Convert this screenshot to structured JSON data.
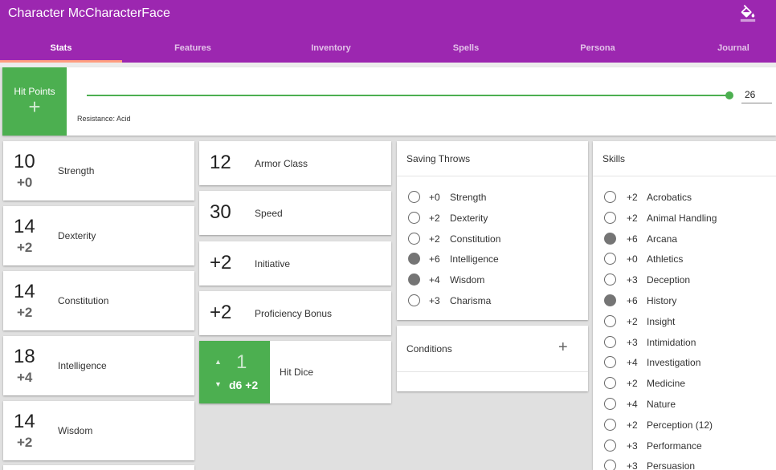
{
  "app": {
    "title": "Character McCharacterFace",
    "theme_color": "#9c27b0",
    "accent_color": "#4caf50",
    "theme_icon": "paint-bucket-icon"
  },
  "tabs": [
    {
      "label": "Stats",
      "active": true
    },
    {
      "label": "Features"
    },
    {
      "label": "Inventory"
    },
    {
      "label": "Spells"
    },
    {
      "label": "Persona"
    },
    {
      "label": "Journal"
    }
  ],
  "hit_points": {
    "label": "Hit Points",
    "add_symbol": "+",
    "value": "26",
    "resistance": "Resistance: Acid"
  },
  "abilities": [
    {
      "score": "10",
      "modifier": "+0",
      "name": "Strength"
    },
    {
      "score": "14",
      "modifier": "+2",
      "name": "Dexterity"
    },
    {
      "score": "14",
      "modifier": "+2",
      "name": "Constitution"
    },
    {
      "score": "18",
      "modifier": "+4",
      "name": "Intelligence"
    },
    {
      "score": "14",
      "modifier": "+2",
      "name": "Wisdom"
    }
  ],
  "combat": [
    {
      "value": "12",
      "label": "Armor Class"
    },
    {
      "value": "30",
      "label": "Speed"
    },
    {
      "value": "+2",
      "label": "Initiative"
    },
    {
      "value": "+2",
      "label": "Proficiency Bonus"
    }
  ],
  "hit_dice": {
    "count": "1",
    "die": "d6 +2",
    "label": "Hit Dice"
  },
  "saving_throws": {
    "title": "Saving Throws",
    "items": [
      {
        "modifier": "+0",
        "name": "Strength",
        "proficient": false
      },
      {
        "modifier": "+2",
        "name": "Dexterity",
        "proficient": false
      },
      {
        "modifier": "+2",
        "name": "Constitution",
        "proficient": false
      },
      {
        "modifier": "+6",
        "name": "Intelligence",
        "proficient": true
      },
      {
        "modifier": "+4",
        "name": "Wisdom",
        "proficient": true
      },
      {
        "modifier": "+3",
        "name": "Charisma",
        "proficient": false
      }
    ]
  },
  "conditions": {
    "title": "Conditions",
    "add_symbol": "+"
  },
  "skills": {
    "title": "Skills",
    "items": [
      {
        "modifier": "+2",
        "name": "Acrobatics",
        "proficient": false
      },
      {
        "modifier": "+2",
        "name": "Animal Handling",
        "proficient": false
      },
      {
        "modifier": "+6",
        "name": "Arcana",
        "proficient": true
      },
      {
        "modifier": "+0",
        "name": "Athletics",
        "proficient": false
      },
      {
        "modifier": "+3",
        "name": "Deception",
        "proficient": false
      },
      {
        "modifier": "+6",
        "name": "History",
        "proficient": true
      },
      {
        "modifier": "+2",
        "name": "Insight",
        "proficient": false
      },
      {
        "modifier": "+3",
        "name": "Intimidation",
        "proficient": false
      },
      {
        "modifier": "+4",
        "name": "Investigation",
        "proficient": false
      },
      {
        "modifier": "+2",
        "name": "Medicine",
        "proficient": false
      },
      {
        "modifier": "+4",
        "name": "Nature",
        "proficient": false
      },
      {
        "modifier": "+2",
        "name": "Perception (12)",
        "proficient": false
      },
      {
        "modifier": "+3",
        "name": "Performance",
        "proficient": false
      },
      {
        "modifier": "+3",
        "name": "Persuasion",
        "proficient": false
      }
    ]
  }
}
